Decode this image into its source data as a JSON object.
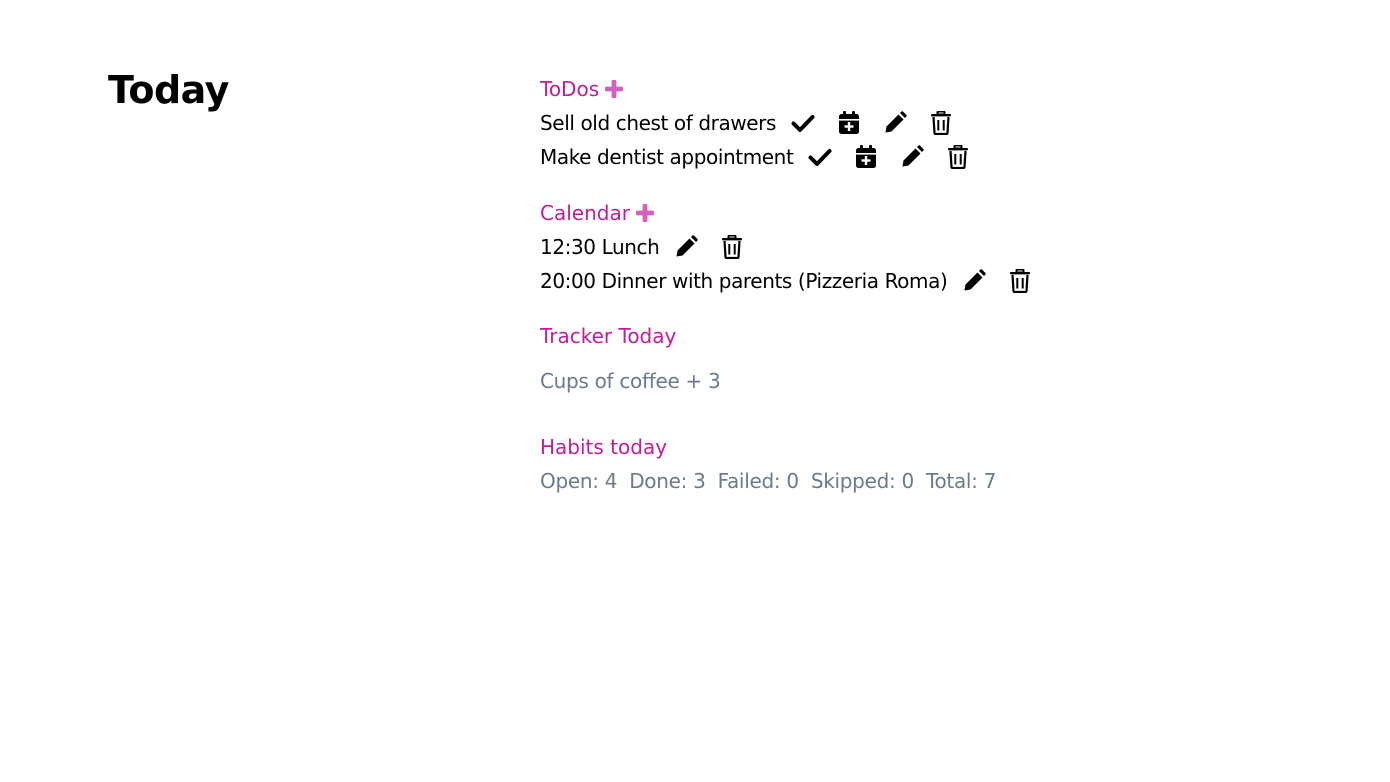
{
  "page": {
    "title": "Today"
  },
  "todos": {
    "heading": "ToDos",
    "items": [
      {
        "label": "Sell old chest of drawers"
      },
      {
        "label": "Make dentist appointment"
      }
    ]
  },
  "calendar": {
    "heading": "Calendar",
    "items": [
      {
        "label": "12:30 Lunch"
      },
      {
        "label": "20:00 Dinner with parents (Pizzeria Roma)"
      }
    ]
  },
  "tracker": {
    "heading": "Tracker Today",
    "entry": "Cups of coffee + 3"
  },
  "habits": {
    "heading": "Habits today",
    "open": "Open: 4",
    "done": "Done: 3",
    "failed": "Failed: 0",
    "skipped": "Skipped: 0",
    "total": "Total: 7"
  },
  "colors": {
    "accent": "#c21c9a",
    "add_icon": "#d561bf",
    "muted_text": "#6b7a90",
    "text": "#000000"
  },
  "icons": {
    "add": "plus-icon",
    "complete": "checkmark-icon",
    "schedule": "calendar-plus-icon",
    "edit": "pencil-icon",
    "delete": "trash-icon"
  }
}
